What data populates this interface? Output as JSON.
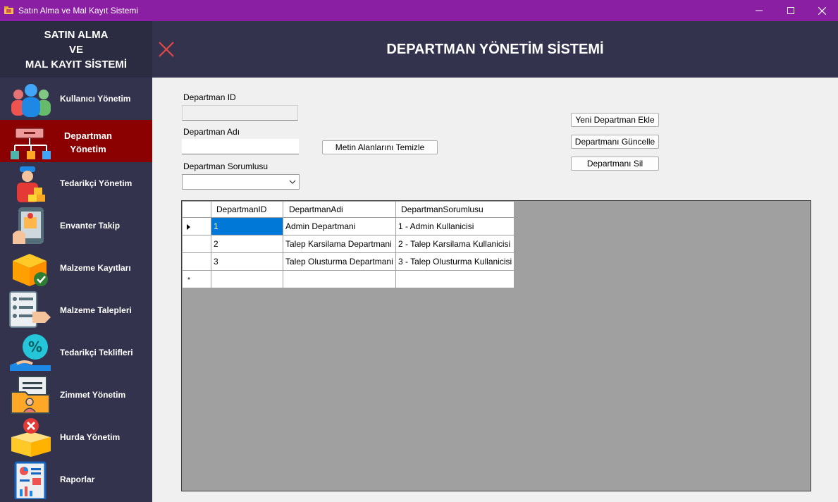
{
  "window": {
    "title": "Satın Alma ve Mal Kayıt Sistemi"
  },
  "sidebar": {
    "header_lines": [
      "SATIN ALMA",
      "VE",
      "MAL KAYIT SİSTEMİ"
    ],
    "items": [
      {
        "label": "Kullanıcı Yönetim",
        "icon": "users-icon"
      },
      {
        "label_lines": [
          "Departman",
          "Yönetim"
        ],
        "icon": "org-chart-icon",
        "active": true
      },
      {
        "label": "Tedarikçi Yönetim",
        "icon": "supplier-icon"
      },
      {
        "label": "Envanter Takip",
        "icon": "inventory-tracking-icon"
      },
      {
        "label": "Malzeme Kayıtları",
        "icon": "material-box-icon"
      },
      {
        "label": "Malzeme Talepleri",
        "icon": "material-request-icon"
      },
      {
        "label": "Tedarikçi Teklifleri",
        "icon": "discount-offer-icon"
      },
      {
        "label": "Zimmet Yönetim",
        "icon": "assignment-folder-icon"
      },
      {
        "label": "Hurda Yönetim",
        "icon": "scrap-box-icon"
      },
      {
        "label": "Raporlar",
        "icon": "report-icon"
      }
    ]
  },
  "header": {
    "title": "DEPARTMAN YÖNETİM SİSTEMİ"
  },
  "form": {
    "id_label": "Departman ID",
    "id_value": "",
    "name_label": "Departman Adı",
    "name_value": "",
    "manager_label": "Departman Sorumlusu",
    "manager_value": "",
    "clear_button": "Metin Alanlarını Temizle",
    "add_button": "Yeni Departman Ekle",
    "update_button": "Departmanı Güncelle",
    "delete_button": "Departmanı Sil"
  },
  "grid": {
    "columns": [
      "DepartmanID",
      "DepartmanAdi",
      "DepartmanSorumlusu"
    ],
    "rows": [
      [
        "1",
        "Admin Departmani",
        "1 - Admin Kullanicisi"
      ],
      [
        "2",
        "Talep Karsilama Departmani",
        "2 - Talep Karsilama Kullanicisi"
      ],
      [
        "3",
        "Talep Olusturma Departmani",
        "3 - Talep Olusturma Kullanicisi"
      ]
    ],
    "new_row_marker": "*"
  },
  "colors": {
    "titlebar": "#8b1fa3",
    "sidebar": "#33334d",
    "active_item": "#8b0000",
    "close_x": "#e04848",
    "selection": "#0078d7"
  }
}
